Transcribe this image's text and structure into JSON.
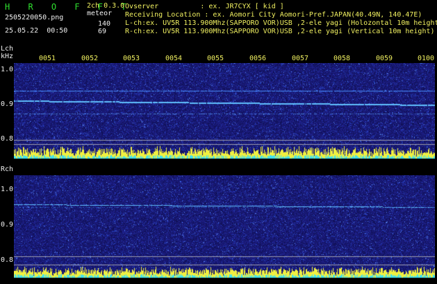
{
  "header": {
    "app_name": "H R O F F T",
    "version": "2ch 0.3.0",
    "filename": "2505220050.png",
    "type_label": "meteor",
    "datetime": "25.05.22  00:50",
    "count_l": "140",
    "count_r": "69",
    "observer": "Ovserver          : ex. JR7CYX [ kid ]",
    "location": "Receiving Location : ex. Aomori City Aomori-Pref.JAPAN(40.49N, 140.47E)",
    "lch_info": "L-ch:ex. UV5R 113.900Mhz(SAPPORO VOR)USB ,2-ele yagi (Holozontal 10m height)",
    "rch_info": "R-ch:ex. UV5R 113.900Mhz(SAPPORO VOR)USB ,2-ele yagi (Vertical 10m height)"
  },
  "time_ticks": [
    "0051",
    "0052",
    "0053",
    "0054",
    "0055",
    "0056",
    "0057",
    "0058",
    "0059",
    "0100"
  ],
  "lch": {
    "label": "Lch",
    "unit": "kHz",
    "freq_labels": [
      "1.0",
      "0.9",
      "0.8"
    ]
  },
  "rch": {
    "label": "Rch",
    "freq_labels": [
      "1.0",
      "0.9",
      "0.8"
    ]
  },
  "colors": {
    "background": "#000000",
    "waterfall": "#101060",
    "signal": "#40c0ff",
    "text_yellow": "#f0f060",
    "text_cyan": "#5fd7ff",
    "brand_green": "#2fe02f",
    "level_yellow": "#f0f040",
    "level_cyan": "#40e0f0"
  }
}
